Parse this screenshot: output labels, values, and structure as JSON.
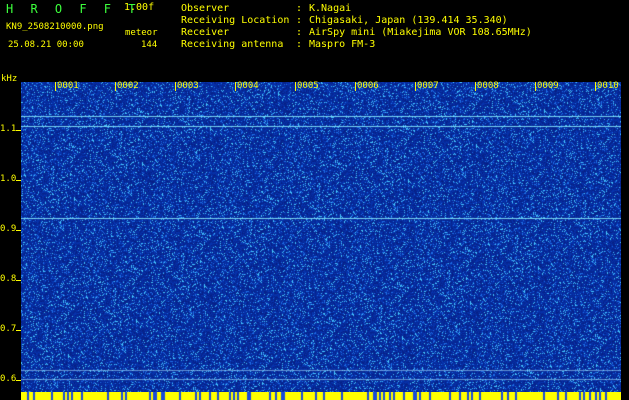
{
  "header": {
    "brand": "H R O F F T",
    "version": "1.00f",
    "filename": "KN9_2508210000.png",
    "meteor_label": "meteor",
    "datetime": "25.08.21 00:00",
    "count": "144"
  },
  "info": [
    {
      "label": "Observer",
      "sep": ":",
      "value": "K.Nagai"
    },
    {
      "label": "Receiving Location",
      "sep": ":",
      "value": "Chigasaki, Japan (139.414 35.340)"
    },
    {
      "label": "Receiver",
      "sep": ":",
      "value": "AirSpy mini (Miakejima VOR 108.65MHz)"
    },
    {
      "label": "Receiving antenna",
      "sep": ":",
      "value": "Maspro FM-3"
    }
  ],
  "axis": {
    "y_unit": "kHz",
    "y_ticks": [
      "1.1",
      "1.0",
      "0.9",
      "0.8",
      "0.7",
      "0.6"
    ],
    "x_labels": [
      "0001",
      "0002",
      "0003",
      "0004",
      "0005",
      "0006",
      "0007",
      "0008",
      "0009",
      "0010"
    ]
  },
  "colors": {
    "background": "#000000",
    "text": "#ffff00",
    "brand": "#3cff3c",
    "spectrum_base": "#0a2aa8",
    "spectrum_line": "#7de8ff",
    "bottom_bar": "#ffff00"
  }
}
